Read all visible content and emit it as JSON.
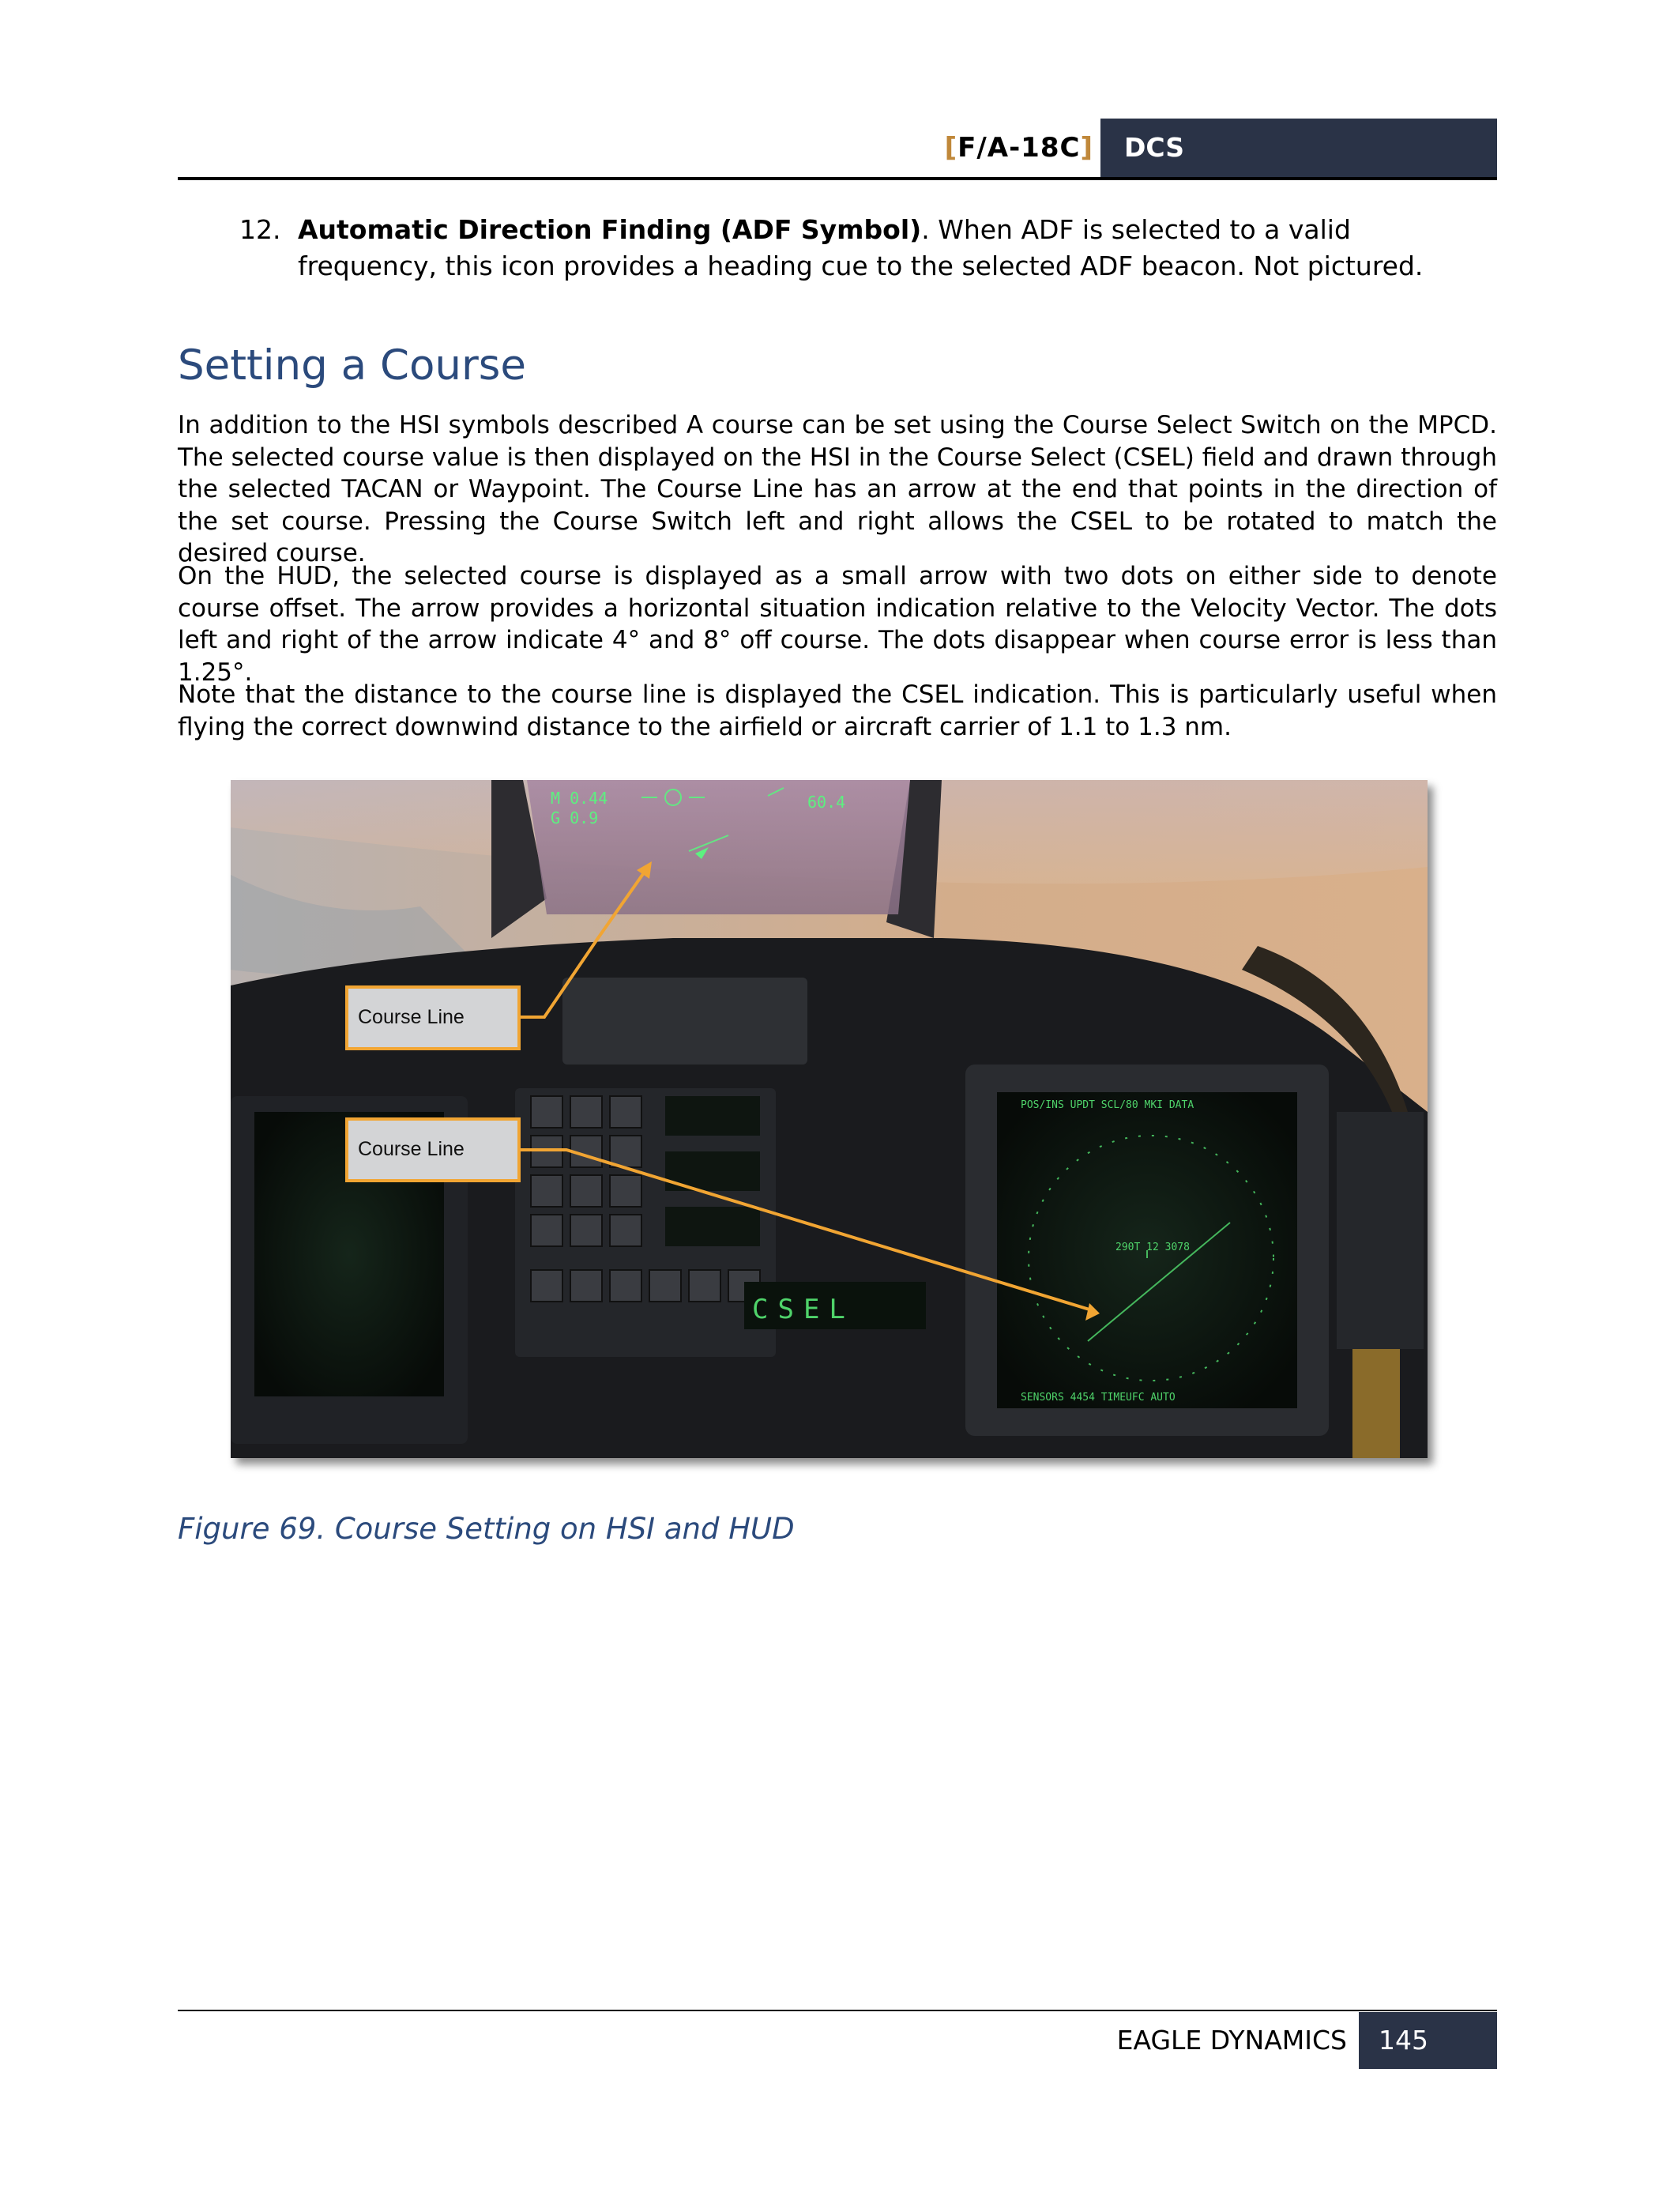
{
  "header": {
    "bracket_open": "[",
    "model": "F/A-18C",
    "bracket_close": "]",
    "tab": "DCS"
  },
  "item12": {
    "number": "12.",
    "title": "Automatic Direction Finding (ADF Symbol)",
    "text": ". When ADF is selected to a valid frequency, this icon provides a heading cue to the selected ADF beacon. Not pictured."
  },
  "section_title": "Setting a Course",
  "paragraphs": [
    "In addition to the HSI symbols described A course can be set using the Course Select Switch on the MPCD. The selected course value is then displayed on the HSI in the Course Select (CSEL) field and drawn through the selected TACAN or Waypoint. The Course Line has an arrow at the end that points in the direction of the set course. Pressing the Course Switch left and right allows the CSEL to be rotated to match the desired course.",
    "On the HUD, the selected course is displayed as a small arrow with two dots on either side to denote course offset. The arrow provides a horizontal situation indication relative to the Velocity Vector. The dots left and right of the arrow indicate 4° and 8° off course. The dots disappear when course error is less than 1.25°.",
    "Note that the distance to the course line is displayed the CSEL indication. This is particularly useful when flying the correct downwind distance to the airfield or aircraft carrier of 1.1 to 1.3 nm."
  ],
  "figure": {
    "callouts": [
      "Course Line",
      "Course Line"
    ],
    "ufc_display": "CSEL",
    "caption": "Figure 69. Course Setting on HSI and HUD",
    "colors": {
      "callout_border": "#f1a533",
      "arrow": "#f1a533",
      "display_green": "#4fd36a"
    }
  },
  "footer": {
    "publisher": "EAGLE DYNAMICS",
    "page": "145"
  }
}
